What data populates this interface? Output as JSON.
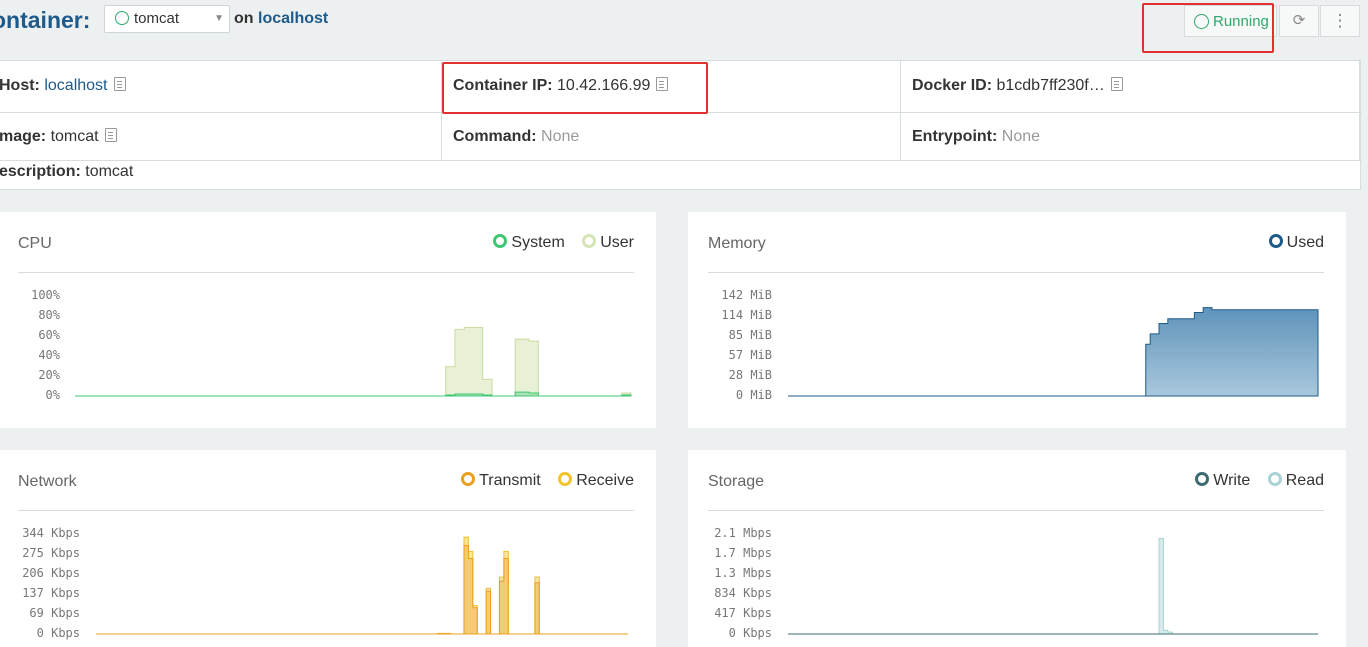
{
  "header": {
    "title": "ontainer:",
    "container_select": "tomcat",
    "on_text": "on",
    "host_link": "localhost",
    "state": "Running",
    "reload_icon": "refresh-icon",
    "more_icon": "kebab-icon"
  },
  "info": {
    "host_label": "Host:",
    "host_value": "localhost",
    "container_ip_label": "Container IP:",
    "container_ip_value": "10.42.166.99",
    "docker_id_label": "Docker ID:",
    "docker_id_value": "b1cdb7ff230f…",
    "image_label": "mage:",
    "image_value": "tomcat",
    "command_label": "Command:",
    "command_value": "None",
    "entrypoint_label": "Entrypoint:",
    "entrypoint_value": "None",
    "description_label": "escription:",
    "description_value": "tomcat"
  },
  "colors": {
    "system": "#3ec773",
    "user": "#d5e4b5",
    "used": "#1e5a8a",
    "transmit": "#e8a020",
    "receive": "#f2c230",
    "write": "#3d6b72",
    "read": "#a9d2d4",
    "running": "#2ea86b",
    "highlight": "#e03030"
  },
  "cards": {
    "cpu": {
      "title": "CPU",
      "legend": [
        "System",
        "User"
      ],
      "yticks": [
        "100%",
        "80%",
        "60%",
        "40%",
        "20%",
        "0%"
      ]
    },
    "memory": {
      "title": "Memory",
      "legend": [
        "Used"
      ],
      "yticks": [
        "142 MiB",
        "114 MiB",
        "85 MiB",
        "57 MiB",
        "28 MiB",
        "0 MiB"
      ]
    },
    "network": {
      "title": "Network",
      "legend": [
        "Transmit",
        "Receive"
      ],
      "yticks": [
        "344 Kbps",
        "275 Kbps",
        "206 Kbps",
        "137 Kbps",
        "69 Kbps",
        "0 Kbps"
      ]
    },
    "storage": {
      "title": "Storage",
      "legend": [
        "Write",
        "Read"
      ],
      "yticks": [
        "2.1 Mbps",
        "1.7 Mbps",
        "1.3 Mbps",
        "834 Kbps",
        "417 Kbps",
        "0 Kbps"
      ]
    }
  },
  "chart_data": [
    {
      "type": "area",
      "title": "CPU",
      "ylim": [
        0,
        100
      ],
      "series": [
        {
          "name": "User",
          "x": [
            0,
            79,
            80,
            82,
            84,
            86,
            88,
            90,
            92,
            94,
            95,
            96,
            98,
            100,
            102,
            103,
            104,
            110,
            112,
            114,
            116,
            118,
            120
          ],
          "values": [
            0,
            0,
            30,
            68,
            70,
            70,
            17,
            0,
            0,
            0,
            58,
            58,
            56,
            0,
            0,
            0,
            0,
            0,
            0,
            0,
            0,
            3,
            0
          ]
        },
        {
          "name": "System",
          "x": [
            0,
            79,
            80,
            82,
            84,
            86,
            88,
            90,
            92,
            94,
            95,
            96,
            98,
            100,
            102,
            103,
            104,
            110,
            112,
            114,
            116,
            118,
            120
          ],
          "values": [
            0,
            0,
            1,
            2,
            2,
            2,
            1,
            0,
            0,
            0,
            4,
            4,
            3,
            0,
            0,
            0,
            0,
            0,
            0,
            0,
            0,
            1,
            0
          ]
        }
      ]
    },
    {
      "type": "area",
      "title": "Memory",
      "ylim": [
        0,
        142
      ],
      "series": [
        {
          "name": "Used",
          "x": [
            0,
            80,
            81,
            82,
            84,
            86,
            88,
            90,
            92,
            94,
            96,
            98,
            100,
            120
          ],
          "values": [
            0,
            0,
            75,
            90,
            105,
            112,
            112,
            112,
            121,
            128,
            125,
            125,
            125,
            125
          ]
        }
      ]
    },
    {
      "type": "area",
      "title": "Network",
      "ylim": [
        0,
        344
      ],
      "series": [
        {
          "name": "Receive",
          "x": [
            0,
            76,
            77,
            80,
            81,
            82,
            83,
            84,
            85,
            86,
            87,
            88,
            89,
            90,
            91,
            92,
            93,
            94,
            95,
            96,
            97,
            98,
            99,
            100
          ],
          "values": [
            0,
            0,
            2,
            0,
            0,
            0,
            340,
            290,
            100,
            0,
            0,
            160,
            0,
            0,
            200,
            290,
            0,
            0,
            0,
            0,
            0,
            0,
            200,
            0
          ]
        },
        {
          "name": "Transmit",
          "x": [
            0,
            76,
            77,
            80,
            81,
            82,
            83,
            84,
            85,
            86,
            87,
            88,
            89,
            90,
            91,
            92,
            93,
            94,
            95,
            96,
            97,
            98,
            99,
            100
          ],
          "values": [
            0,
            0,
            1,
            0,
            0,
            0,
            310,
            265,
            92,
            0,
            0,
            150,
            0,
            0,
            185,
            265,
            0,
            0,
            0,
            0,
            0,
            0,
            180,
            0
          ]
        }
      ]
    },
    {
      "type": "area",
      "title": "Storage",
      "ylim": [
        0,
        2100
      ],
      "series": [
        {
          "name": "Read",
          "x": [
            0,
            83,
            84,
            85,
            86,
            87,
            100
          ],
          "values": [
            0,
            0,
            2050,
            80,
            40,
            0,
            0
          ]
        },
        {
          "name": "Write",
          "x": [
            0,
            100
          ],
          "values": [
            0,
            0
          ]
        }
      ]
    }
  ]
}
